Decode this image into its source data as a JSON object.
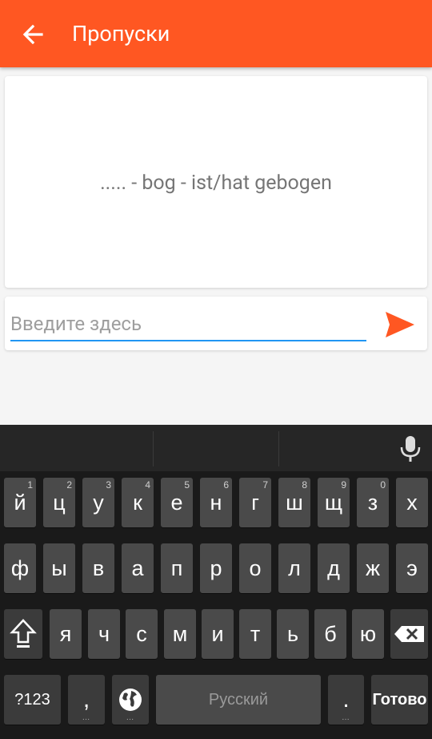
{
  "app_bar": {
    "title": "Пропуски",
    "color": "#ff5722"
  },
  "question": {
    "text": "..... - bog - ist/hat gebogen"
  },
  "answer": {
    "placeholder": "Введите здесь",
    "value": ""
  },
  "keyboard": {
    "row1": [
      {
        "label": "й",
        "hint": "1"
      },
      {
        "label": "ц",
        "hint": "2"
      },
      {
        "label": "у",
        "hint": "3"
      },
      {
        "label": "к",
        "hint": "4"
      },
      {
        "label": "е",
        "hint": "5"
      },
      {
        "label": "н",
        "hint": "6"
      },
      {
        "label": "г",
        "hint": "7"
      },
      {
        "label": "ш",
        "hint": "8"
      },
      {
        "label": "щ",
        "hint": "9"
      },
      {
        "label": "з",
        "hint": "0"
      },
      {
        "label": "х",
        "hint": ""
      }
    ],
    "row2": [
      "ф",
      "ы",
      "в",
      "а",
      "п",
      "р",
      "о",
      "л",
      "д",
      "ж",
      "э"
    ],
    "row3": [
      "я",
      "ч",
      "с",
      "м",
      "и",
      "т",
      "ь",
      "б",
      "ю"
    ],
    "symbols_label": "?123",
    "comma_label": ",",
    "space_label": "Русский",
    "period_label": ".",
    "done_label": "Готово"
  }
}
